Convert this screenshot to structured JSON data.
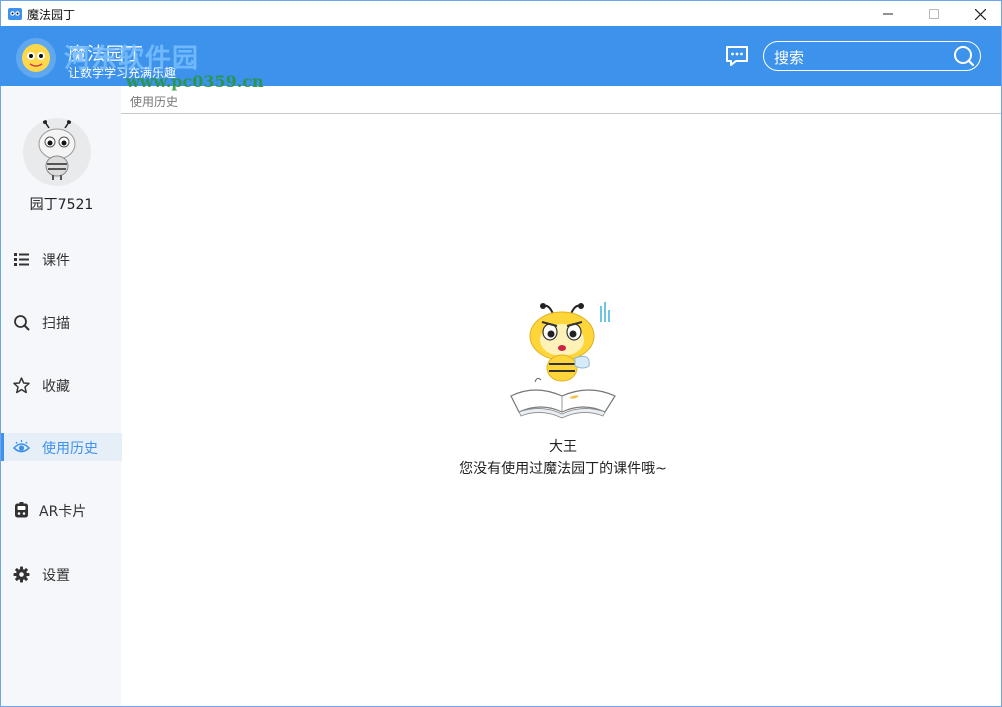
{
  "window": {
    "title": "魔法园丁"
  },
  "header": {
    "app_name": "魔法园丁",
    "slogan": "让数学学习充满乐趣",
    "watermark": "河东软件园",
    "watermark_url": "www.pc0359.cn",
    "search_placeholder": "搜索"
  },
  "user": {
    "name": "园丁7521"
  },
  "sidebar": {
    "items": [
      {
        "label": "课件",
        "icon": "list-icon"
      },
      {
        "label": "扫描",
        "icon": "search-icon"
      },
      {
        "label": "收藏",
        "icon": "star-icon"
      },
      {
        "label": "使用历史",
        "icon": "eye-icon",
        "active": true
      },
      {
        "label": "AR卡片",
        "icon": "ar-card-icon"
      },
      {
        "label": "设置",
        "icon": "gear-icon"
      }
    ]
  },
  "main": {
    "breadcrumb": "使用历史",
    "empty_title": "大王",
    "empty_message": "您没有使用过魔法园丁的课件哦~"
  },
  "colors": {
    "accent": "#3d92ec",
    "sidebar_bg": "#f5f7fa",
    "active_bg": "#e6eef8"
  }
}
